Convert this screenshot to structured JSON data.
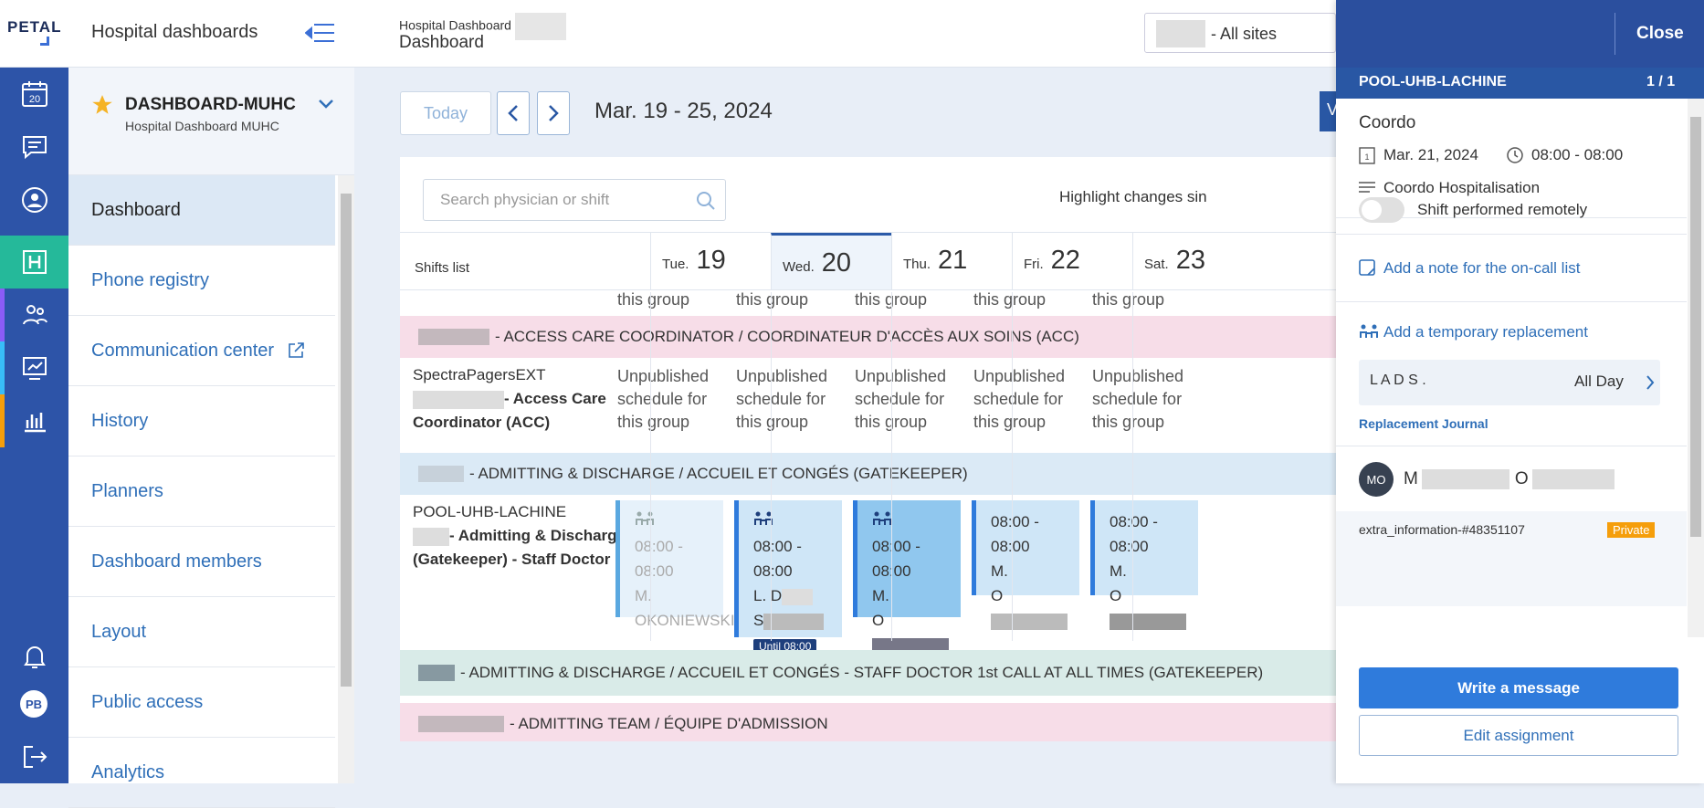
{
  "header": {
    "logo": "PETAL",
    "app_title": "Hospital dashboards",
    "breadcrumb": "Hospital Dashboard",
    "page_title": "Dashboard",
    "sites_label": "- All sites"
  },
  "rail": {
    "calendar_day": "20",
    "user_initials": "PB"
  },
  "sidebar": {
    "dashboard_name": "DASHBOARD-MUHC",
    "dashboard_sub": "Hospital Dashboard MUHC",
    "items": [
      {
        "label": "Dashboard"
      },
      {
        "label": "Phone registry"
      },
      {
        "label": "Communication center"
      },
      {
        "label": "History"
      },
      {
        "label": "Planners"
      },
      {
        "label": "Dashboard members"
      },
      {
        "label": "Layout"
      },
      {
        "label": "Public access"
      },
      {
        "label": "Analytics"
      }
    ]
  },
  "toolbar": {
    "today": "Today",
    "date_range": "Mar. 19 - 25, 2024",
    "blue_btn": "V"
  },
  "grid": {
    "search_placeholder": "Search physician or shift",
    "highlight_label": "Highlight changes sin",
    "shifts_list": "Shifts list",
    "days": [
      {
        "dn": "Tue.",
        "num": "19"
      },
      {
        "dn": "Wed.",
        "num": "20"
      },
      {
        "dn": "Thu.",
        "num": "21"
      },
      {
        "dn": "Fri.",
        "num": "22"
      },
      {
        "dn": "Sat.",
        "num": "23"
      }
    ],
    "this_group": "this group",
    "sec_acc": "- ACCESS CARE COORDINATOR / COORDINATEUR D'ACCÈS AUX SOINS (ACC)",
    "acc_loc": "SpectraPagersEXT",
    "acc_role1": "- Access Care",
    "acc_role2": "Coordinator (ACC)",
    "unpub1": "Unpublished",
    "unpub2": "schedule for",
    "unpub3": "this group",
    "sec_gate": "- ADMITTING & DISCHARGE / ACCUEIL ET CONGÉS (GATEKEEPER)",
    "gate_loc": "POOL-UHB-LACHINE",
    "gate_role1": "- Admitting & Discharge",
    "gate_role2": "(Gatekeeper) - Staff Doctor",
    "time": "08:00 - 08:00",
    "c1_name1": "M.",
    "c1_name2": "OKONIEWSKI",
    "c2_name1": "L. D",
    "c2_name2": "S",
    "c2_badge": "Until 08:00",
    "c3_name1": "M.",
    "c3_name2": "O",
    "c4_name1": "M.",
    "c4_name2": "O",
    "sec_staff": "- ADMITTING & DISCHARGE / ACCUEIL ET CONGÉS - STAFF DOCTOR 1st CALL AT ALL TIMES (GATEKEEPER)",
    "sec_team": "- ADMITTING TEAM / ÉQUIPE D'ADMISSION"
  },
  "panel": {
    "close": "Close",
    "group": "POOL-UHB-LACHINE",
    "count": "1 / 1",
    "title": "Coordo",
    "date": "Mar. 21, 2024",
    "time": "08:00 - 08:00",
    "desc": "Coordo Hospitalisation",
    "remote": "Shift performed remotely",
    "add_note": "Add a note for the on-call list",
    "add_repl": "Add a temporary replacement",
    "repl_name": "L A D S .",
    "repl_when": "All Day",
    "journal": "Replacement Journal",
    "initials": "MO",
    "member_first": "M",
    "member_last": "O",
    "extra": "extra_information-#48351107",
    "private": "Private",
    "write": "Write a message",
    "edit": "Edit assignment"
  },
  "colors": {
    "accent": "#2b4f9e",
    "teal": "#25b99a",
    "pink_row": "#f7dde8",
    "blue_row": "#dbeaf6",
    "green_row": "#d9ebe8"
  }
}
